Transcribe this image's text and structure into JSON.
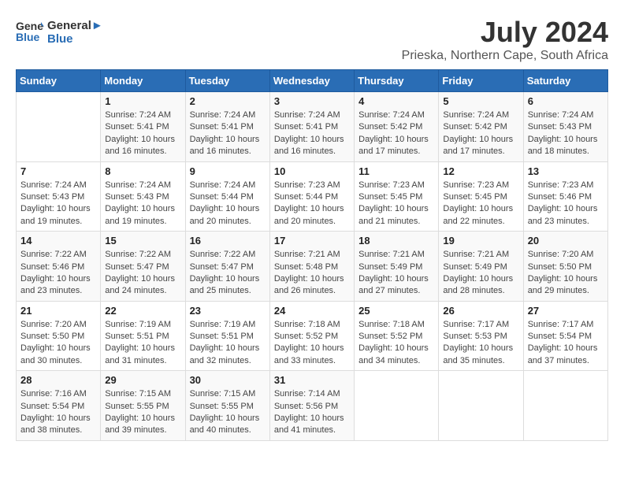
{
  "header": {
    "logo_line1": "General",
    "logo_line2": "Blue",
    "month_year": "July 2024",
    "location": "Prieska, Northern Cape, South Africa"
  },
  "days_of_week": [
    "Sunday",
    "Monday",
    "Tuesday",
    "Wednesday",
    "Thursday",
    "Friday",
    "Saturday"
  ],
  "weeks": [
    [
      {
        "day": "",
        "info": ""
      },
      {
        "day": "1",
        "info": "Sunrise: 7:24 AM\nSunset: 5:41 PM\nDaylight: 10 hours\nand 16 minutes."
      },
      {
        "day": "2",
        "info": "Sunrise: 7:24 AM\nSunset: 5:41 PM\nDaylight: 10 hours\nand 16 minutes."
      },
      {
        "day": "3",
        "info": "Sunrise: 7:24 AM\nSunset: 5:41 PM\nDaylight: 10 hours\nand 16 minutes."
      },
      {
        "day": "4",
        "info": "Sunrise: 7:24 AM\nSunset: 5:42 PM\nDaylight: 10 hours\nand 17 minutes."
      },
      {
        "day": "5",
        "info": "Sunrise: 7:24 AM\nSunset: 5:42 PM\nDaylight: 10 hours\nand 17 minutes."
      },
      {
        "day": "6",
        "info": "Sunrise: 7:24 AM\nSunset: 5:43 PM\nDaylight: 10 hours\nand 18 minutes."
      }
    ],
    [
      {
        "day": "7",
        "info": "Sunrise: 7:24 AM\nSunset: 5:43 PM\nDaylight: 10 hours\nand 19 minutes."
      },
      {
        "day": "8",
        "info": "Sunrise: 7:24 AM\nSunset: 5:43 PM\nDaylight: 10 hours\nand 19 minutes."
      },
      {
        "day": "9",
        "info": "Sunrise: 7:24 AM\nSunset: 5:44 PM\nDaylight: 10 hours\nand 20 minutes."
      },
      {
        "day": "10",
        "info": "Sunrise: 7:23 AM\nSunset: 5:44 PM\nDaylight: 10 hours\nand 20 minutes."
      },
      {
        "day": "11",
        "info": "Sunrise: 7:23 AM\nSunset: 5:45 PM\nDaylight: 10 hours\nand 21 minutes."
      },
      {
        "day": "12",
        "info": "Sunrise: 7:23 AM\nSunset: 5:45 PM\nDaylight: 10 hours\nand 22 minutes."
      },
      {
        "day": "13",
        "info": "Sunrise: 7:23 AM\nSunset: 5:46 PM\nDaylight: 10 hours\nand 23 minutes."
      }
    ],
    [
      {
        "day": "14",
        "info": "Sunrise: 7:22 AM\nSunset: 5:46 PM\nDaylight: 10 hours\nand 23 minutes."
      },
      {
        "day": "15",
        "info": "Sunrise: 7:22 AM\nSunset: 5:47 PM\nDaylight: 10 hours\nand 24 minutes."
      },
      {
        "day": "16",
        "info": "Sunrise: 7:22 AM\nSunset: 5:47 PM\nDaylight: 10 hours\nand 25 minutes."
      },
      {
        "day": "17",
        "info": "Sunrise: 7:21 AM\nSunset: 5:48 PM\nDaylight: 10 hours\nand 26 minutes."
      },
      {
        "day": "18",
        "info": "Sunrise: 7:21 AM\nSunset: 5:49 PM\nDaylight: 10 hours\nand 27 minutes."
      },
      {
        "day": "19",
        "info": "Sunrise: 7:21 AM\nSunset: 5:49 PM\nDaylight: 10 hours\nand 28 minutes."
      },
      {
        "day": "20",
        "info": "Sunrise: 7:20 AM\nSunset: 5:50 PM\nDaylight: 10 hours\nand 29 minutes."
      }
    ],
    [
      {
        "day": "21",
        "info": "Sunrise: 7:20 AM\nSunset: 5:50 PM\nDaylight: 10 hours\nand 30 minutes."
      },
      {
        "day": "22",
        "info": "Sunrise: 7:19 AM\nSunset: 5:51 PM\nDaylight: 10 hours\nand 31 minutes."
      },
      {
        "day": "23",
        "info": "Sunrise: 7:19 AM\nSunset: 5:51 PM\nDaylight: 10 hours\nand 32 minutes."
      },
      {
        "day": "24",
        "info": "Sunrise: 7:18 AM\nSunset: 5:52 PM\nDaylight: 10 hours\nand 33 minutes."
      },
      {
        "day": "25",
        "info": "Sunrise: 7:18 AM\nSunset: 5:52 PM\nDaylight: 10 hours\nand 34 minutes."
      },
      {
        "day": "26",
        "info": "Sunrise: 7:17 AM\nSunset: 5:53 PM\nDaylight: 10 hours\nand 35 minutes."
      },
      {
        "day": "27",
        "info": "Sunrise: 7:17 AM\nSunset: 5:54 PM\nDaylight: 10 hours\nand 37 minutes."
      }
    ],
    [
      {
        "day": "28",
        "info": "Sunrise: 7:16 AM\nSunset: 5:54 PM\nDaylight: 10 hours\nand 38 minutes."
      },
      {
        "day": "29",
        "info": "Sunrise: 7:15 AM\nSunset: 5:55 PM\nDaylight: 10 hours\nand 39 minutes."
      },
      {
        "day": "30",
        "info": "Sunrise: 7:15 AM\nSunset: 5:55 PM\nDaylight: 10 hours\nand 40 minutes."
      },
      {
        "day": "31",
        "info": "Sunrise: 7:14 AM\nSunset: 5:56 PM\nDaylight: 10 hours\nand 41 minutes."
      },
      {
        "day": "",
        "info": ""
      },
      {
        "day": "",
        "info": ""
      },
      {
        "day": "",
        "info": ""
      }
    ]
  ]
}
